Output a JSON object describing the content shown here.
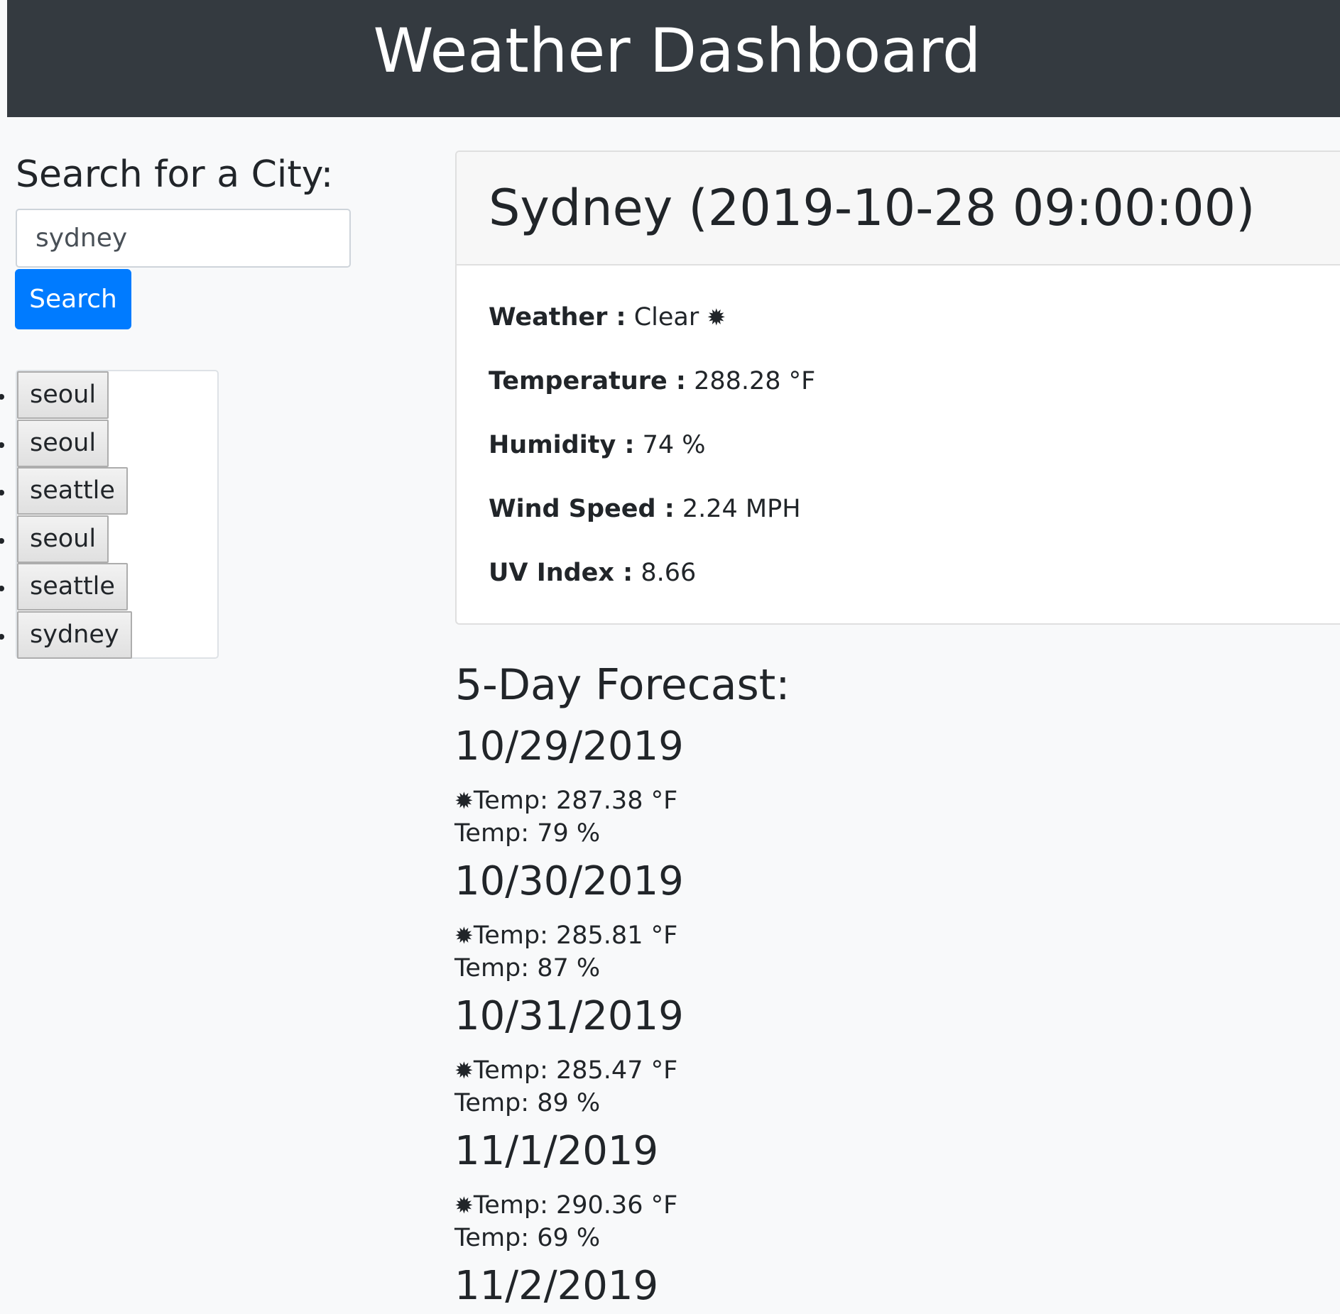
{
  "header": {
    "title": "Weather Dashboard"
  },
  "search": {
    "heading": "Search for a City:",
    "input_value": "sydney",
    "button_label": "Search"
  },
  "history": [
    "seoul",
    "seoul",
    "seattle",
    "seoul",
    "seattle",
    "sydney"
  ],
  "current": {
    "title": "Sydney (2019-10-28 09:00:00)",
    "weather_label": "Weather :",
    "weather_value": "Clear",
    "weather_icon": "sun-icon",
    "temperature_label": "Temperature :",
    "temperature_value": "288.28 °F",
    "humidity_label": "Humidity :",
    "humidity_value": "74 %",
    "wind_label": "Wind Speed :",
    "wind_value": "2.24 MPH",
    "uv_label": "UV Index :",
    "uv_value": "8.66"
  },
  "forecast": {
    "heading": "5-Day Forecast:",
    "days": [
      {
        "date": "10/29/2019",
        "temp": "Temp: 287.38 °F",
        "humidity": "Temp: 79 %",
        "icon": "sun-icon"
      },
      {
        "date": "10/30/2019",
        "temp": "Temp: 285.81 °F",
        "humidity": "Temp: 87 %",
        "icon": "sun-icon"
      },
      {
        "date": "10/31/2019",
        "temp": "Temp: 285.47 °F",
        "humidity": "Temp: 89 %",
        "icon": "sun-icon"
      },
      {
        "date": "11/1/2019",
        "temp": "Temp: 290.36 °F",
        "humidity": "Temp: 69 %",
        "icon": "sun-icon"
      },
      {
        "date": "11/2/2019"
      }
    ]
  }
}
